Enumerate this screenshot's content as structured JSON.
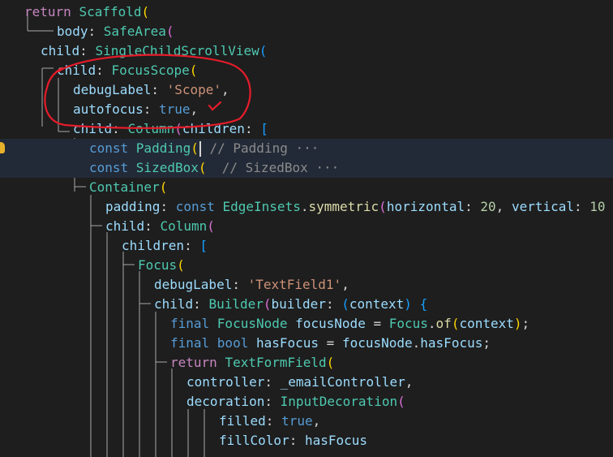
{
  "colors": {
    "background": "#1e1e1e",
    "line_highlight": "#232a37",
    "annotation": "#e51c2a",
    "guide": "#a8a8a8"
  },
  "code_lines": [
    [
      {
        "t": "return ",
        "c": "ctl"
      },
      {
        "t": "Scaffold",
        "c": "cls"
      },
      {
        "t": "(",
        "c": "p1"
      }
    ],
    [
      {
        "t": "body",
        "c": "prop"
      },
      {
        "t": ": ",
        "c": "plain"
      },
      {
        "t": "SafeArea",
        "c": "cls"
      },
      {
        "t": "(",
        "c": "p2"
      }
    ],
    [
      {
        "t": "child",
        "c": "prop"
      },
      {
        "t": ": ",
        "c": "plain"
      },
      {
        "t": "SingleChildScrollView",
        "c": "cls"
      },
      {
        "t": "(",
        "c": "p3"
      }
    ],
    [
      {
        "t": "child",
        "c": "prop"
      },
      {
        "t": ": ",
        "c": "plain"
      },
      {
        "t": "FocusScope",
        "c": "cls"
      },
      {
        "t": "(",
        "c": "p1"
      }
    ],
    [
      {
        "t": "debugLabel",
        "c": "prop"
      },
      {
        "t": ": ",
        "c": "plain"
      },
      {
        "t": "'Scope'",
        "c": "str"
      },
      {
        "t": ",",
        "c": "plain"
      }
    ],
    [
      {
        "t": "autofocus",
        "c": "prop"
      },
      {
        "t": ": ",
        "c": "plain"
      },
      {
        "t": "true",
        "c": "kw"
      },
      {
        "t": ",",
        "c": "plain"
      }
    ],
    [
      {
        "t": "child",
        "c": "prop"
      },
      {
        "t": ": ",
        "c": "plain"
      },
      {
        "t": "Column",
        "c": "cls"
      },
      {
        "t": "(",
        "c": "p2"
      },
      {
        "t": "children",
        "c": "prop"
      },
      {
        "t": ": ",
        "c": "plain"
      },
      {
        "t": "[",
        "c": "p3"
      }
    ],
    [
      {
        "t": "const ",
        "c": "kw"
      },
      {
        "t": "Padding",
        "c": "cls"
      },
      {
        "t": "(",
        "c": "p1"
      },
      {
        "caret": true
      },
      {
        "t": " // Padding ···",
        "c": "cmt"
      }
    ],
    [
      {
        "t": "const ",
        "c": "kw"
      },
      {
        "t": "SizedBox",
        "c": "cls"
      },
      {
        "t": "(",
        "c": "p1"
      },
      {
        "t": "  // SizedBox ···",
        "c": "cmt"
      }
    ],
    [
      {
        "t": "Container",
        "c": "cls"
      },
      {
        "t": "(",
        "c": "p1"
      }
    ],
    [
      {
        "t": "padding",
        "c": "prop"
      },
      {
        "t": ": ",
        "c": "plain"
      },
      {
        "t": "const ",
        "c": "kw"
      },
      {
        "t": "EdgeInsets",
        "c": "cls"
      },
      {
        "t": ".",
        "c": "plain"
      },
      {
        "t": "symmetric",
        "c": "fn"
      },
      {
        "t": "(",
        "c": "p2"
      },
      {
        "t": "horizontal",
        "c": "prop"
      },
      {
        "t": ": ",
        "c": "plain"
      },
      {
        "t": "20",
        "c": "num"
      },
      {
        "t": ", ",
        "c": "plain"
      },
      {
        "t": "vertical",
        "c": "prop"
      },
      {
        "t": ": ",
        "c": "plain"
      },
      {
        "t": "10",
        "c": "num"
      }
    ],
    [
      {
        "t": "child",
        "c": "prop"
      },
      {
        "t": ": ",
        "c": "plain"
      },
      {
        "t": "Column",
        "c": "cls"
      },
      {
        "t": "(",
        "c": "p2"
      }
    ],
    [
      {
        "t": "children",
        "c": "prop"
      },
      {
        "t": ": ",
        "c": "plain"
      },
      {
        "t": "[",
        "c": "p3"
      }
    ],
    [
      {
        "t": "Focus",
        "c": "cls"
      },
      {
        "t": "(",
        "c": "p1"
      }
    ],
    [
      {
        "t": "debugLabel",
        "c": "prop"
      },
      {
        "t": ": ",
        "c": "plain"
      },
      {
        "t": "'TextField1'",
        "c": "str"
      },
      {
        "t": ",",
        "c": "plain"
      }
    ],
    [
      {
        "t": "child",
        "c": "prop"
      },
      {
        "t": ": ",
        "c": "plain"
      },
      {
        "t": "Builder",
        "c": "cls"
      },
      {
        "t": "(",
        "c": "p2"
      },
      {
        "t": "builder",
        "c": "prop"
      },
      {
        "t": ": ",
        "c": "plain"
      },
      {
        "t": "(",
        "c": "p3"
      },
      {
        "t": "context",
        "c": "prop"
      },
      {
        "t": ")",
        "c": "p3"
      },
      {
        "t": " ",
        "c": "plain"
      },
      {
        "t": "{",
        "c": "p3"
      }
    ],
    [
      {
        "t": "final ",
        "c": "kw"
      },
      {
        "t": "FocusNode ",
        "c": "cls"
      },
      {
        "t": "focusNode",
        "c": "prop"
      },
      {
        "t": " = ",
        "c": "plain"
      },
      {
        "t": "Focus",
        "c": "cls"
      },
      {
        "t": ".",
        "c": "plain"
      },
      {
        "t": "of",
        "c": "fn"
      },
      {
        "t": "(",
        "c": "p1"
      },
      {
        "t": "context",
        "c": "prop"
      },
      {
        "t": ")",
        "c": "p1"
      },
      {
        "t": ";",
        "c": "plain"
      }
    ],
    [
      {
        "t": "final ",
        "c": "kw"
      },
      {
        "t": "bool ",
        "c": "kw"
      },
      {
        "t": "hasFocus",
        "c": "prop"
      },
      {
        "t": " = ",
        "c": "plain"
      },
      {
        "t": "focusNode",
        "c": "prop"
      },
      {
        "t": ".",
        "c": "plain"
      },
      {
        "t": "hasFocus",
        "c": "prop"
      },
      {
        "t": ";",
        "c": "plain"
      }
    ],
    [
      {
        "t": "return ",
        "c": "ctl"
      },
      {
        "t": "TextFormField",
        "c": "cls"
      },
      {
        "t": "(",
        "c": "p1"
      }
    ],
    [
      {
        "t": "controller",
        "c": "prop"
      },
      {
        "t": ": ",
        "c": "plain"
      },
      {
        "t": "_emailController",
        "c": "prop"
      },
      {
        "t": ",",
        "c": "plain"
      }
    ],
    [
      {
        "t": "decoration",
        "c": "prop"
      },
      {
        "t": ": ",
        "c": "plain"
      },
      {
        "t": "InputDecoration",
        "c": "cls"
      },
      {
        "t": "(",
        "c": "p2"
      }
    ],
    [
      {
        "t": "filled",
        "c": "prop"
      },
      {
        "t": ": ",
        "c": "plain"
      },
      {
        "t": "true",
        "c": "kw"
      },
      {
        "t": ",",
        "c": "plain"
      }
    ],
    [
      {
        "t": "fillColor",
        "c": "prop"
      },
      {
        "t": ": ",
        "c": "plain"
      },
      {
        "t": "hasFocus",
        "c": "prop"
      }
    ]
  ]
}
